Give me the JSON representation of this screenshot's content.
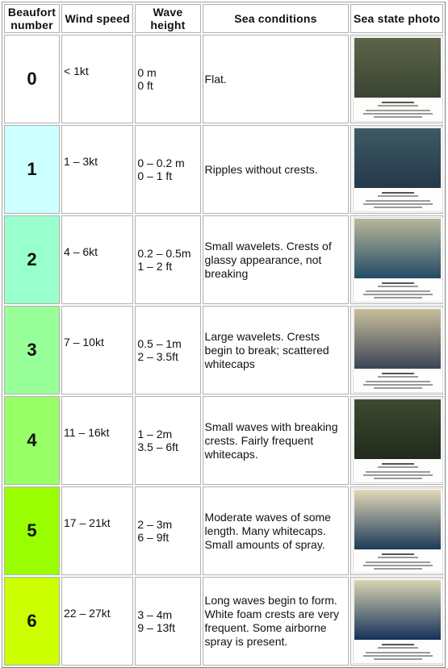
{
  "table": {
    "headers": {
      "beaufort": "Beaufort number",
      "wind": "Wind speed",
      "wave": "Wave height",
      "conditions": "Sea conditions",
      "photo": "Sea state photo"
    },
    "rows": [
      {
        "number": "0",
        "color": "#ffffff",
        "wind": "< 1kt",
        "wave_m": "0 m",
        "wave_ft": "0 ft",
        "conditions": "Flat.",
        "photo_icon": "sea-photo-force-0",
        "photo_tone": [
          "#5c6448",
          "#3a4433"
        ]
      },
      {
        "number": "1",
        "color": "#ccffff",
        "wind": "1 – 3kt",
        "wave_m": "0 – 0.2 m",
        "wave_ft": "0 – 1 ft",
        "conditions": "Ripples without crests.",
        "photo_icon": "sea-photo-force-1",
        "photo_tone": [
          "#3e5a64",
          "#24384a"
        ]
      },
      {
        "number": "2",
        "color": "#99ffcc",
        "wind": "4 – 6kt",
        "wave_m": "0.2 – 0.5m",
        "wave_ft": "1 – 2 ft",
        "conditions": "Small wavelets. Crests of glassy appearance, not breaking",
        "photo_icon": "sea-photo-force-2",
        "photo_tone": [
          "#b8b89a",
          "#234a66"
        ]
      },
      {
        "number": "3",
        "color": "#99ff99",
        "wind": "7 – 10kt",
        "wave_m": "0.5 – 1m",
        "wave_ft": "2 – 3.5ft",
        "conditions": "Large wavelets. Crests begin to break; scattered whitecaps",
        "photo_icon": "sea-photo-force-3",
        "photo_tone": [
          "#c8bf9a",
          "#3a4456"
        ]
      },
      {
        "number": "4",
        "color": "#99ff66",
        "wind": "11 – 16kt",
        "wave_m": "1 – 2m",
        "wave_ft": "3.5 – 6ft",
        "conditions": "Small waves with breaking crests. Fairly frequent whitecaps.",
        "photo_icon": "sea-photo-force-4",
        "photo_tone": [
          "#3c4a30",
          "#222a1c"
        ]
      },
      {
        "number": "5",
        "color": "#99ff00",
        "wind": "17 – 21kt",
        "wave_m": "2 – 3m",
        "wave_ft": "6 – 9ft",
        "conditions": "Moderate waves of some length. Many whitecaps. Small amounts of spray.",
        "photo_icon": "sea-photo-force-5",
        "photo_tone": [
          "#e2d8b8",
          "#1c3a58"
        ]
      },
      {
        "number": "6",
        "color": "#ccff00",
        "wind": "22 – 27kt",
        "wave_m": "3 – 4m",
        "wave_ft": "9 – 13ft",
        "conditions": "Long waves begin to form. White foam crests are very frequent. Some airborne spray is present.",
        "photo_icon": "sea-photo-force-6",
        "photo_tone": [
          "#d8d4b0",
          "#14305a"
        ]
      }
    ]
  }
}
